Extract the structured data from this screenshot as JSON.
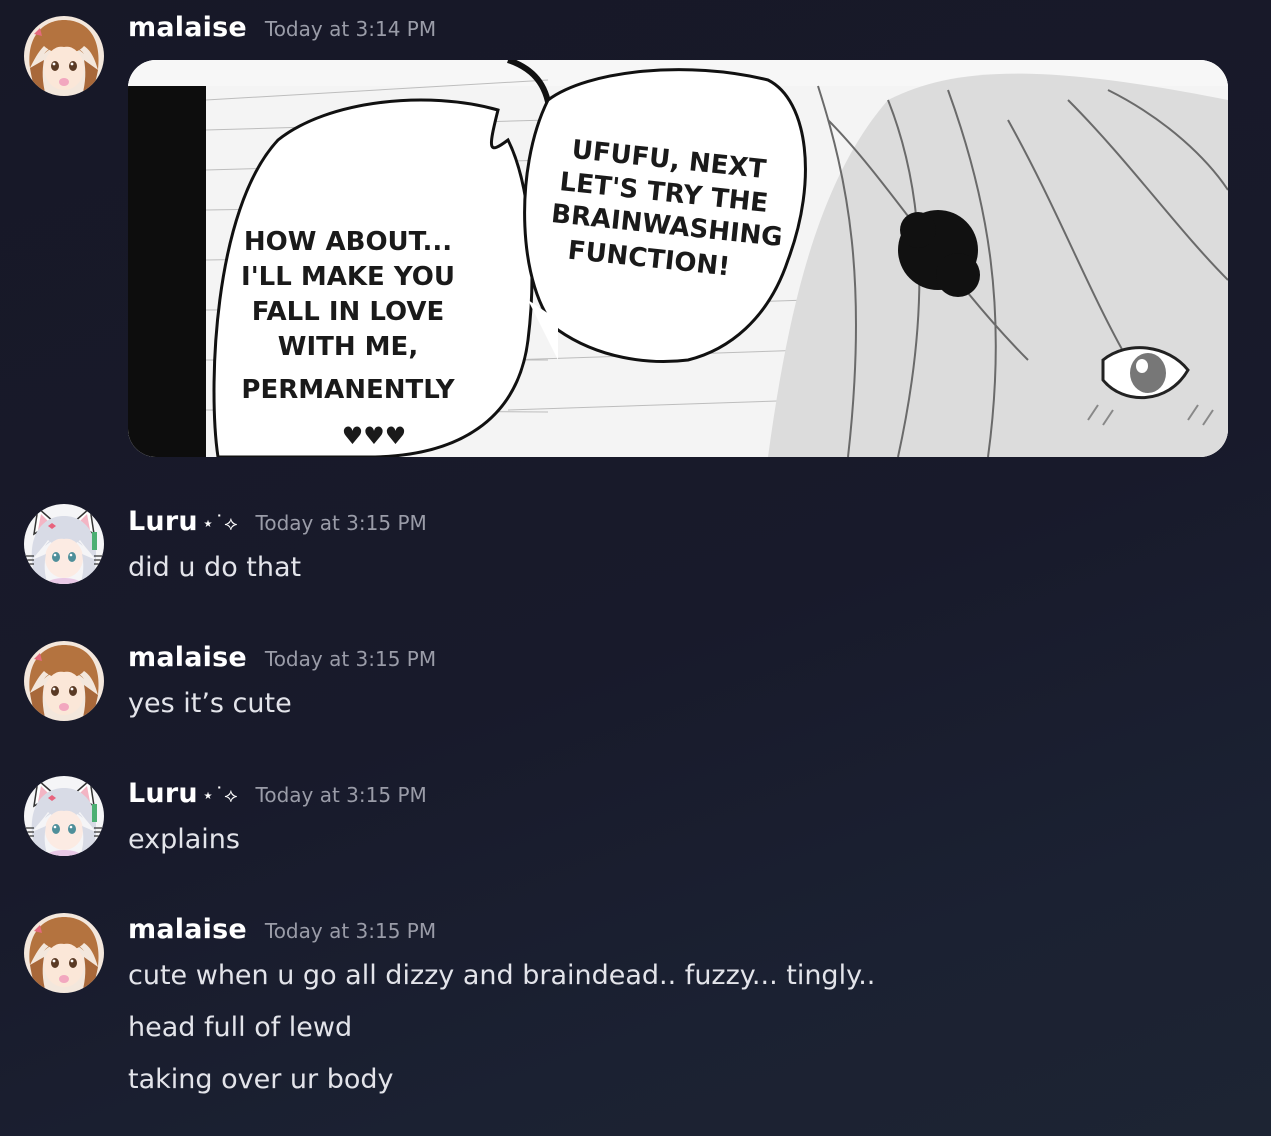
{
  "messages": [
    {
      "username": "malaise",
      "timestamp": "Today at 3:14 PM",
      "avatar": "brown-haired-anime-girl-avatar",
      "attachment": {
        "type": "manga-panel-image",
        "bubble_left": [
          "HOW ABOUT...",
          "I'LL MAKE YOU",
          "FALL IN LOVE",
          "WITH ME,",
          "PERMANENTLY",
          "♥♥♥"
        ],
        "bubble_right": [
          "UFUFU, NEXT",
          "LET'S TRY THE",
          "BRAINWASHING",
          "FUNCTION!"
        ]
      }
    },
    {
      "username": "Luru",
      "username_deco": "⋆˙⟡",
      "timestamp": "Today at 3:15 PM",
      "avatar": "silver-haired-cat-ear-girl-avatar",
      "lines": [
        "did u do that"
      ]
    },
    {
      "username": "malaise",
      "timestamp": "Today at 3:15 PM",
      "avatar": "brown-haired-anime-girl-avatar",
      "lines": [
        "yes it’s cute"
      ]
    },
    {
      "username": "Luru",
      "username_deco": "⋆˙⟡",
      "timestamp": "Today at 3:15 PM",
      "avatar": "silver-haired-cat-ear-girl-avatar",
      "lines": [
        "explains"
      ]
    },
    {
      "username": "malaise",
      "timestamp": "Today at 3:15 PM",
      "avatar": "brown-haired-anime-girl-avatar",
      "lines": [
        "cute when u go all dizzy and braindead.. fuzzy... tingly..",
        "head full of lewd",
        "taking over ur body"
      ]
    }
  ],
  "colors": {
    "background": "#171827",
    "username": "#ffffff",
    "timestamp": "#9a9ca8",
    "message_text": "#e3e4ea"
  }
}
